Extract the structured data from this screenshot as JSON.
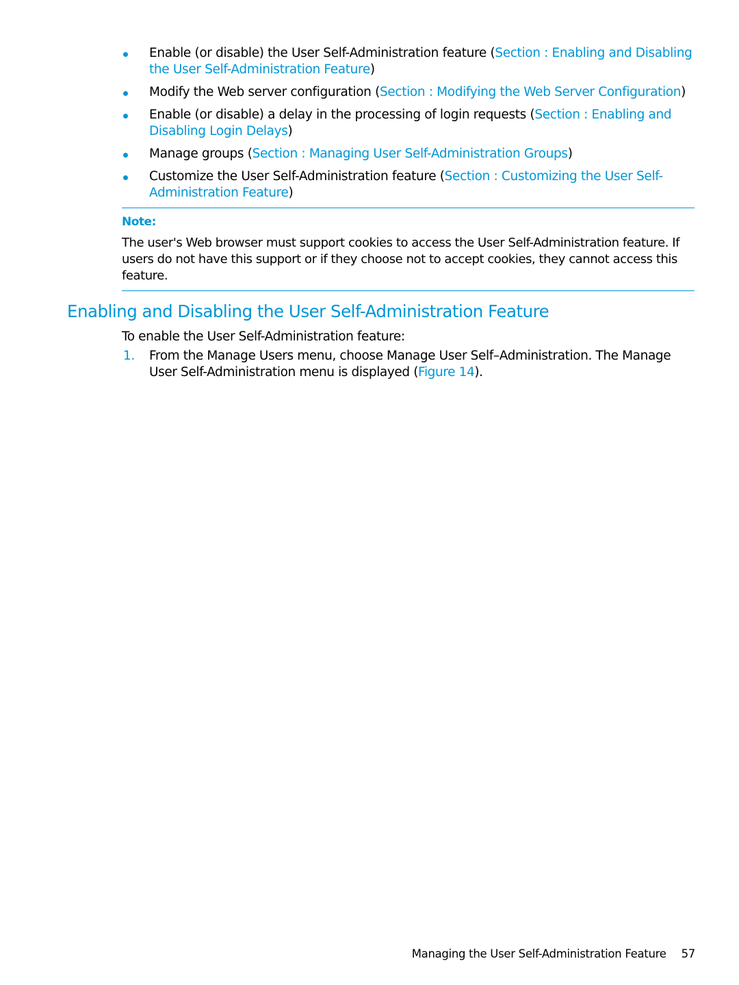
{
  "bullets": [
    {
      "text": "Enable (or disable) the User Self-Administration feature (",
      "link": "Section : Enabling and Disabling the User Self-Administration Feature",
      "after": ")"
    },
    {
      "text": "Modify the Web server configuration (",
      "link": "Section : Modifying the Web Server Configuration",
      "after": ")"
    },
    {
      "text": "Enable (or disable) a delay in the processing of login requests (",
      "link": "Section : Enabling and Disabling Login Delays",
      "after": ")"
    },
    {
      "text": "Manage groups (",
      "link": "Section : Managing User Self-Administration Groups",
      "after": ")"
    },
    {
      "text": "Customize the User Self-Administration feature (",
      "link": "Section : Customizing the User Self-Administration Feature",
      "after": ")"
    }
  ],
  "note": {
    "label": "Note:",
    "body": "The user's Web browser must support cookies to access the User Self-Administration feature. If users do not have this support or if they choose not to accept cookies, they cannot access this feature."
  },
  "section": {
    "heading": "Enabling and Disabling the User Self-Administration Feature",
    "intro": "To enable the User Self-Administration feature:",
    "steps": [
      {
        "number": "1.",
        "text": "From the Manage Users menu, choose Manage User Self–Administration. The Manage User Self-Administration menu is displayed (",
        "link": "Figure 14",
        "after": ")."
      }
    ]
  },
  "footer": {
    "title": "Managing the User Self-Administration Feature",
    "page": "57"
  },
  "colors": {
    "accent": "#0096d6",
    "text": "#000000"
  }
}
